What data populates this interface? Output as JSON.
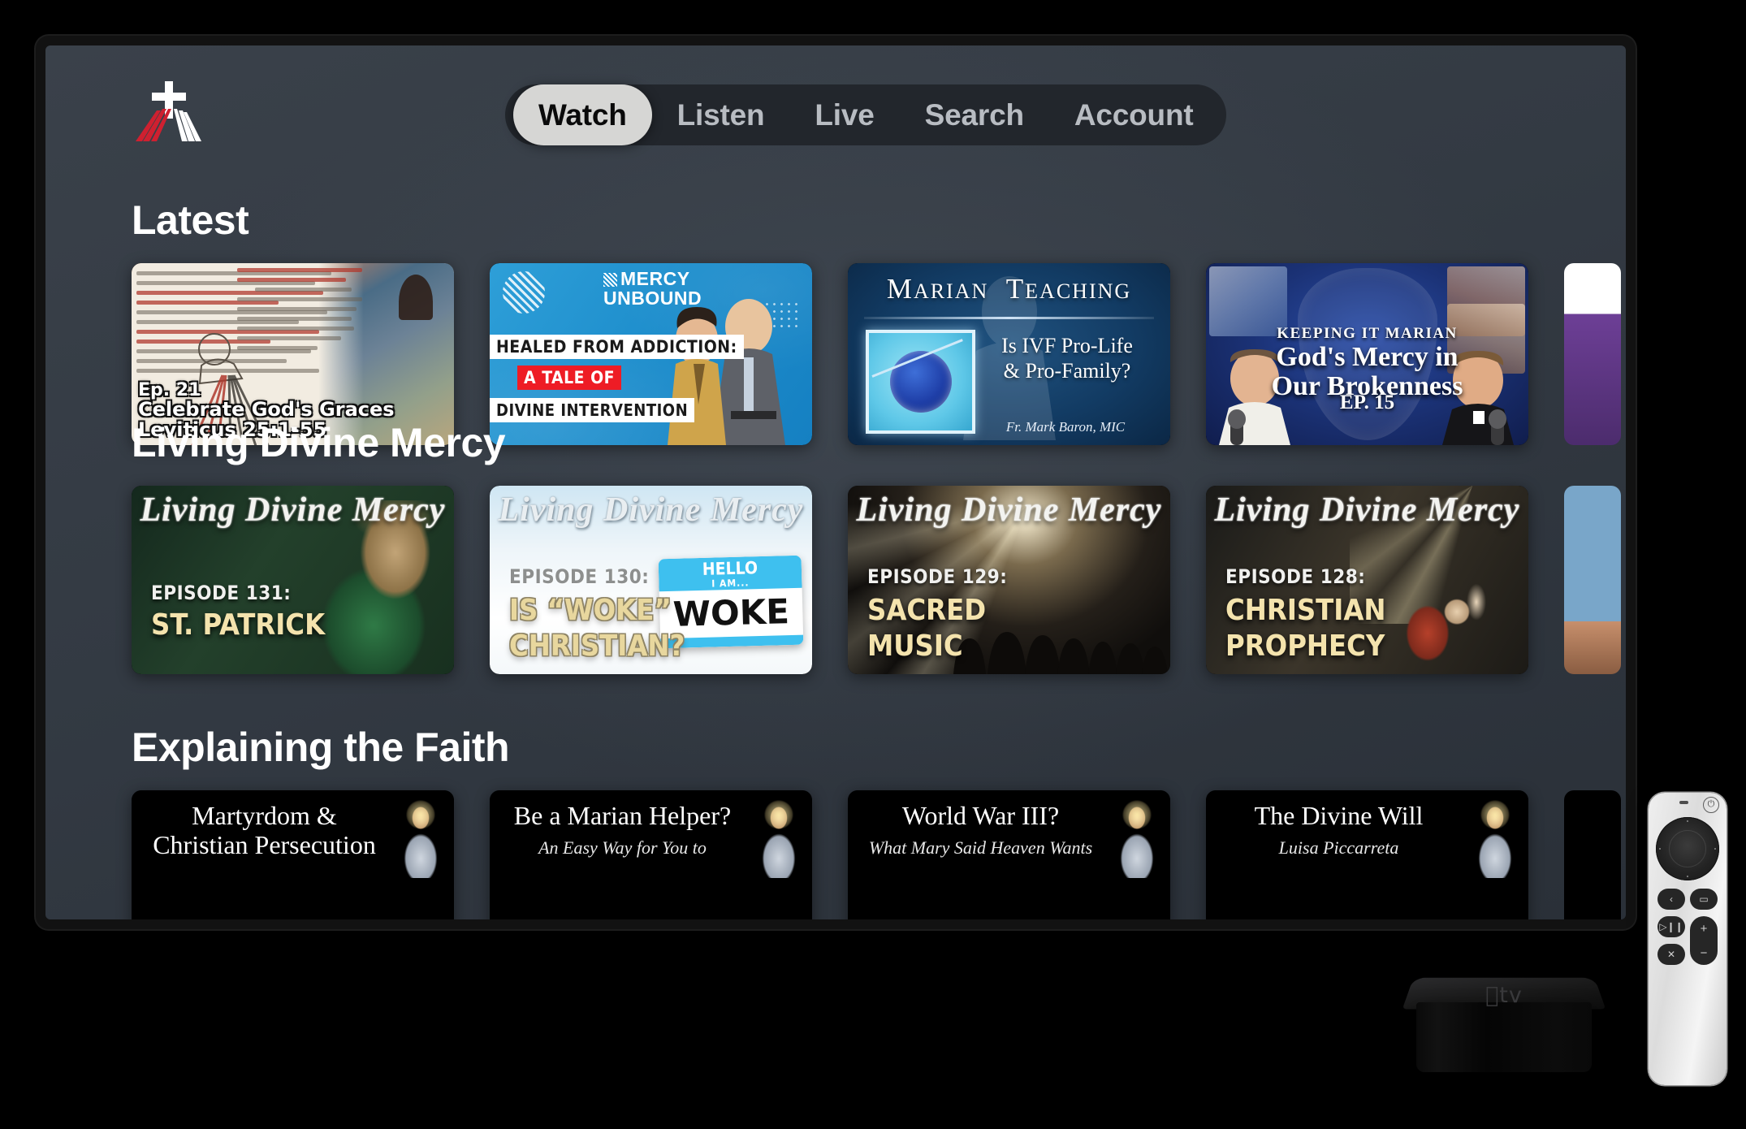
{
  "app": {
    "logo_name": "divine-mercy-cross-logo",
    "logo_colors": {
      "rays_red": "#cf2030",
      "rays_white": "#ffffff",
      "cross": "#ffffff"
    },
    "screen_bg": "#373e47"
  },
  "nav": {
    "tabs": [
      {
        "label": "Watch",
        "active": true
      },
      {
        "label": "Listen",
        "active": false
      },
      {
        "label": "Live",
        "active": false
      },
      {
        "label": "Search",
        "active": false
      },
      {
        "label": "Account",
        "active": false
      }
    ]
  },
  "rows": [
    {
      "title": "Latest",
      "tiles": [
        {
          "kind": "bible",
          "line1": "Ep. 21",
          "line2": "Celebrate God's Graces",
          "line3": "Leviticus 25:1-55"
        },
        {
          "kind": "mercy-unbound",
          "brand_line1": "MERCY",
          "brand_line2": "UNBOUND",
          "label1": "HEALED FROM ADDICTION:",
          "label2": "A TALE OF",
          "label3": "DIVINE INTERVENTION",
          "accent": "#ee1c25"
        },
        {
          "kind": "marian-teaching",
          "title_a": "M",
          "title_b": "ARIAN",
          "title_c": "T",
          "title_d": "EACHING",
          "sub1": "Is IVF Pro-Life",
          "sub2": "& Pro-Family?",
          "byline": "Fr. Mark Baron, MIC"
        },
        {
          "kind": "keeping-it-marian",
          "kicker": "KEEPING IT MARIAN",
          "title1": "God's Mercy in",
          "title2": "Our Brokenness",
          "episode": "EP. 15"
        }
      ],
      "peek": "peek-1"
    },
    {
      "title": "Living Divine Mercy",
      "tiles": [
        {
          "kind": "ldm-patrick",
          "show": "Living Divine Mercy",
          "episode": "EPISODE 131:",
          "title1": "ST. PATRICK",
          "title2": ""
        },
        {
          "kind": "ldm-woke",
          "show": "Living Divine Mercy",
          "episode": "EPISODE 130:",
          "title1": "IS “WOKE”",
          "title2": "CHRISTIAN?",
          "tag_hello": "HELLO",
          "tag_iam": "I AM...",
          "tag_word": "WOKE"
        },
        {
          "kind": "ldm-music",
          "show": "Living Divine Mercy",
          "episode": "EPISODE 129:",
          "title1": "SACRED",
          "title2": "MUSIC"
        },
        {
          "kind": "ldm-proph",
          "show": "Living Divine Mercy",
          "episode": "EPISODE 128:",
          "title1": "CHRISTIAN",
          "title2": "PROPHECY"
        }
      ],
      "peek": "peek-2"
    },
    {
      "title": "Explaining the Faith",
      "tiles": [
        {
          "kind": "faith",
          "title1": "Martyrdom &",
          "title2": "Christian Persecution",
          "sub": ""
        },
        {
          "kind": "faith",
          "title1": "Be a Marian Helper?",
          "title2": "",
          "sub": "An Easy Way for You to"
        },
        {
          "kind": "faith",
          "title1": "World War III?",
          "title2": "",
          "sub": "What Mary Said Heaven Wants"
        },
        {
          "kind": "faith",
          "title1": "The Divine Will",
          "title2": "",
          "sub": "Luisa Piccarreta"
        }
      ],
      "peek": "peek-3"
    }
  ],
  "hardware": {
    "box": {
      "wordmark": "tv",
      "name": "apple-tv-box"
    },
    "remote": {
      "name": "apple-tv-siri-remote",
      "power_glyph": "⏻",
      "back_glyph": "‹",
      "tv_glyph": "▭",
      "play_glyph": "▷❙❙",
      "mute_glyph": "✕",
      "volume_up": "+",
      "volume_down": "−"
    }
  }
}
